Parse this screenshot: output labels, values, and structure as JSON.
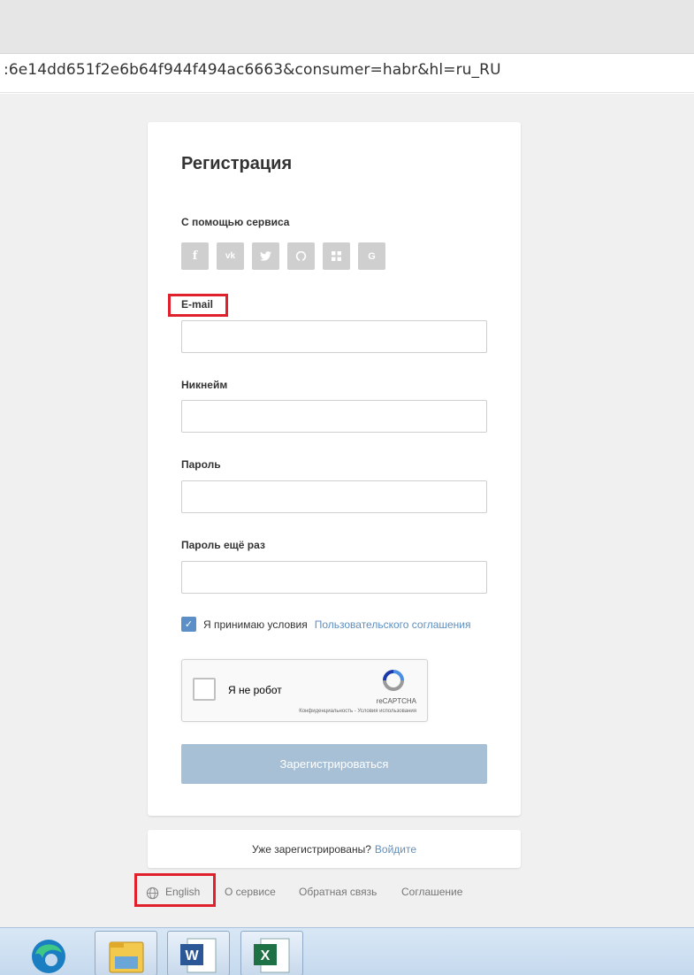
{
  "browser": {
    "url_text": ":6e14dd651f2e6b64f944f494ac6663&consumer=habr&hl=ru_RU"
  },
  "form": {
    "title": "Регистрация",
    "social_label": "С помощью сервиса",
    "social_icons": [
      "facebook-icon",
      "vk-icon",
      "twitter-icon",
      "github-icon",
      "microsoft-icon",
      "google-icon"
    ],
    "social_glyphs": [
      "f",
      "vk",
      "t",
      "gh",
      "ms",
      "G"
    ],
    "email_label": "E-mail",
    "email_value": "",
    "nickname_label": "Никнейм",
    "nickname_value": "",
    "password_label": "Пароль",
    "password_value": "",
    "password_repeat_label": "Пароль ещё раз",
    "password_repeat_value": "",
    "agree_text": "Я принимаю условия",
    "agree_link": "Пользовательского соглашения",
    "agree_checked": true,
    "captcha": {
      "label": "Я не робот",
      "brand": "reCAPTCHA",
      "links": "Конфиденциальность - Условия использования"
    },
    "submit_label": "Зарегистрироваться"
  },
  "login_prompt": {
    "text": "Уже зарегистрированы?",
    "link": "Войдите"
  },
  "footer": {
    "language": "English",
    "about": "О сервисе",
    "feedback": "Обратная связь",
    "agreement": "Соглашение"
  },
  "colors": {
    "accent": "#5f8fbf",
    "submit_disabled": "#a8c0d6",
    "highlight_box": "#e0212b"
  },
  "taskbar": {
    "items": [
      "edge-icon",
      "file-explorer-icon",
      "word-icon",
      "excel-icon"
    ]
  }
}
